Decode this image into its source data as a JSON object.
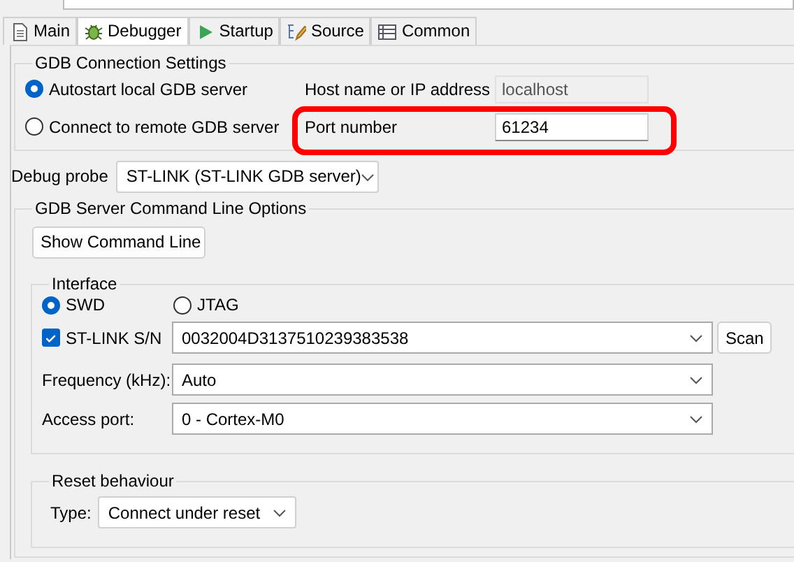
{
  "tabs": [
    {
      "label": "Main",
      "kind": "document",
      "selected": false
    },
    {
      "label": "Debugger",
      "kind": "bug",
      "selected": true
    },
    {
      "label": "Startup",
      "kind": "play",
      "selected": false
    },
    {
      "label": "Source",
      "kind": "source",
      "selected": false
    },
    {
      "label": "Common",
      "kind": "table",
      "selected": false
    }
  ],
  "gdb_connection": {
    "title": "GDB Connection Settings",
    "options": [
      {
        "label": "Autostart local GDB server",
        "selected": true
      },
      {
        "label": "Connect to remote GDB server",
        "selected": false
      }
    ],
    "host": {
      "label": "Host name or IP address",
      "value": "localhost",
      "disabled": true
    },
    "port": {
      "label": "Port number",
      "value": "61234",
      "disabled": false,
      "highlighted": true
    }
  },
  "debug_probe": {
    "label": "Debug probe",
    "value": "ST-LINK (ST-LINK GDB server)"
  },
  "server_options": {
    "title": "GDB Server Command Line Options",
    "show_command_line_button": "Show Command Line",
    "interface": {
      "title": "Interface",
      "modes": [
        {
          "label": "SWD",
          "selected": true
        },
        {
          "label": "JTAG",
          "selected": false
        }
      ],
      "serial": {
        "label": "ST-LINK S/N",
        "checked": true,
        "value": "0032004D3137510239383538"
      },
      "scan_button": "Scan",
      "frequency": {
        "label": "Frequency (kHz):",
        "value": "Auto"
      },
      "access_port": {
        "label": "Access port:",
        "value": "0 - Cortex-M0"
      }
    },
    "reset": {
      "title": "Reset behaviour",
      "type": {
        "label": "Type:",
        "value": "Connect under reset"
      }
    }
  }
}
